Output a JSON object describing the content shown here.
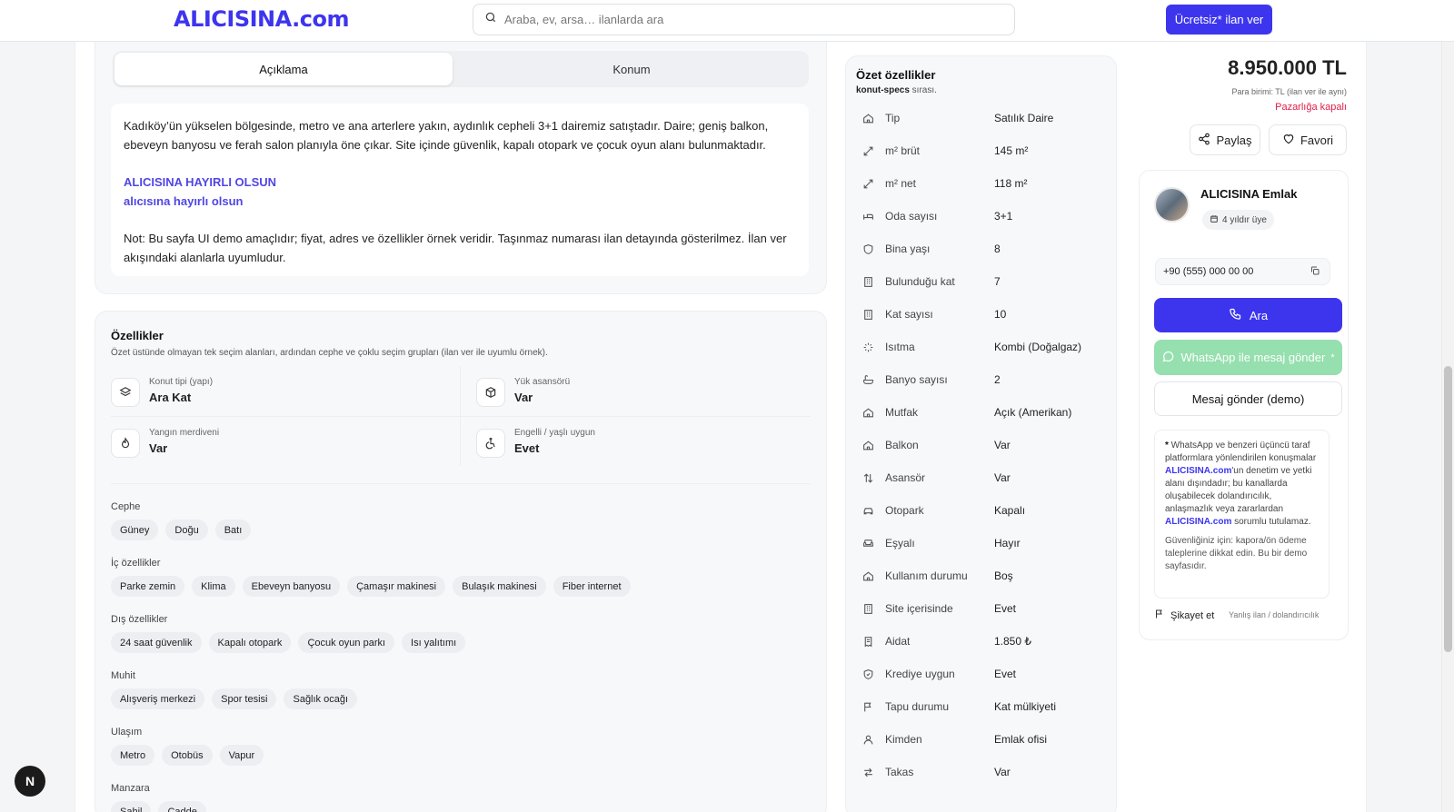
{
  "header": {
    "logo": "ALICISINA.com",
    "search_placeholder": "Araba, ev, arsa… ilanlarda ara",
    "post_button": "Ücretsiz* ilan ver"
  },
  "tabs": [
    "Açıklama",
    "Konum"
  ],
  "description": {
    "paragraph1": "Kadıköy’ün yükselen bölgesinde, metro ve ana arterlere yakın, aydınlık cepheli 3+1 dairemiz satıştadır. Daire; geniş balkon, ebeveyn banyosu ve ferah salon planıyla öne çıkar. Site içinde güvenlik, kapalı otopark ve çocuk oyun alanı bulunmaktadır.",
    "accent1": "ALICISINA HAYIRLI OLSUN",
    "accent2": "alıcısına hayırlı olsun",
    "paragraph2": "Not: Bu sayfa UI demo amaçlıdır; fiyat, adres ve özellikler örnek veridir. Taşınmaz numarası ilan detayında gösterilmez. İlan ver akışındaki alanlarla uyumludur."
  },
  "features": {
    "title": "Özellikler",
    "subtitle": "Özet üstünde olmayan tek seçim alanları, ardından cephe ve çoklu seçim grupları (ilan ver ile uyumlu örnek).",
    "items": [
      {
        "label": "Konut tipi (yapı)",
        "value": "Ara Kat",
        "icon": "layers-icon"
      },
      {
        "label": "Yük asansörü",
        "value": "Var",
        "icon": "box-icon"
      },
      {
        "label": "Yangın merdiveni",
        "value": "Var",
        "icon": "flame-icon"
      },
      {
        "label": "Engelli / yaşlı uygun",
        "value": "Evet",
        "icon": "accessibility-icon"
      }
    ],
    "groups": [
      {
        "label": "Cephe",
        "chips": [
          "Güney",
          "Doğu",
          "Batı"
        ]
      },
      {
        "label": "İç özellikler",
        "chips": [
          "Parke zemin",
          "Klima",
          "Ebeveyn banyosu",
          "Çamaşır makinesi",
          "Bulaşık makinesi",
          "Fiber internet"
        ]
      },
      {
        "label": "Dış özellikler",
        "chips": [
          "24 saat güvenlik",
          "Kapalı otopark",
          "Çocuk oyun parkı",
          "Isı yalıtımı"
        ]
      },
      {
        "label": "Muhit",
        "chips": [
          "Alışveriş merkezi",
          "Spor tesisi",
          "Sağlık ocağı"
        ]
      },
      {
        "label": "Ulaşım",
        "chips": [
          "Metro",
          "Otobüs",
          "Vapur"
        ]
      },
      {
        "label": "Manzara",
        "chips": [
          "Sahil",
          "Cadde"
        ]
      }
    ]
  },
  "summary": {
    "title": "Özet özellikler",
    "subtitle_code": "konut-specs",
    "subtitle_rest": " sırası.",
    "rows": [
      {
        "label": "Tip",
        "value": "Satılık Daire",
        "icon": "home-icon"
      },
      {
        "label": "m² brüt",
        "value": "145 m²",
        "icon": "expand-icon"
      },
      {
        "label": "m² net",
        "value": "118 m²",
        "icon": "expand-icon"
      },
      {
        "label": "Oda sayısı",
        "value": "3+1",
        "icon": "bed-icon"
      },
      {
        "label": "Bina yaşı",
        "value": "8",
        "icon": "shield-icon"
      },
      {
        "label": "Bulunduğu kat",
        "value": "7",
        "icon": "building-icon"
      },
      {
        "label": "Kat sayısı",
        "value": "10",
        "icon": "building-icon"
      },
      {
        "label": "Isıtma",
        "value": "Kombi (Doğalgaz)",
        "icon": "sparkle-icon"
      },
      {
        "label": "Banyo sayısı",
        "value": "2",
        "icon": "bath-icon"
      },
      {
        "label": "Mutfak",
        "value": "Açık (Amerikan)",
        "icon": "home-icon"
      },
      {
        "label": "Balkon",
        "value": "Var",
        "icon": "home-icon"
      },
      {
        "label": "Asansör",
        "value": "Var",
        "icon": "arrows-updown-icon"
      },
      {
        "label": "Otopark",
        "value": "Kapalı",
        "icon": "car-icon"
      },
      {
        "label": "Eşyalı",
        "value": "Hayır",
        "icon": "sofa-icon"
      },
      {
        "label": "Kullanım durumu",
        "value": "Boş",
        "icon": "home-icon"
      },
      {
        "label": "Site içerisinde",
        "value": "Evet",
        "icon": "building-icon"
      },
      {
        "label": "Aidat",
        "value": "1.850 ₺",
        "icon": "receipt-icon"
      },
      {
        "label": "Krediye uygun",
        "value": "Evet",
        "icon": "shield-check-icon"
      },
      {
        "label": "Tapu durumu",
        "value": "Kat mülkiyeti",
        "icon": "flag-icon"
      },
      {
        "label": "Kimden",
        "value": "Emlak ofisi",
        "icon": "user-icon"
      },
      {
        "label": "Takas",
        "value": "Var",
        "icon": "swap-icon"
      }
    ]
  },
  "price": {
    "amount": "8.950.000 TL",
    "currency_note": "Para birimi: TL (ilan ver ile aynı)",
    "negotiable": "Pazarlığa kapalı"
  },
  "actions": {
    "share": "Paylaş",
    "favorite": "Favori"
  },
  "seller": {
    "name": "ALICISINA Emlak",
    "member_since": "4 yıldır üye",
    "phone": "+90 (555) 000 00 00",
    "call": "Ara",
    "whatsapp": "WhatsApp ile mesaj gönder",
    "whatsapp_mark": "*",
    "message": "Mesaj gönder (demo)",
    "note_star": "*",
    "note_p1a": " WhatsApp ve benzeri üçüncü taraf platformlara yönlendirilen konuşmalar ",
    "note_brand1": "ALICISINA.com",
    "note_p1b": "'un denetim ve yetki alanı dışındadır; bu kanallarda oluşabilecek dolandırıcılık, anlaşmazlık veya zararlardan ",
    "note_brand2": "ALICISINA.com",
    "note_p1c": " sorumlu tutulamaz.",
    "note_p2": "Güvenliğiniz için: kapora/ön ödeme taleplerine dikkat edin. Bu bir demo sayfasıdır.",
    "report": "Şikayet et",
    "report_sub": "Yanlış ilan / dolandırıcılık"
  },
  "floating_badge": "N"
}
